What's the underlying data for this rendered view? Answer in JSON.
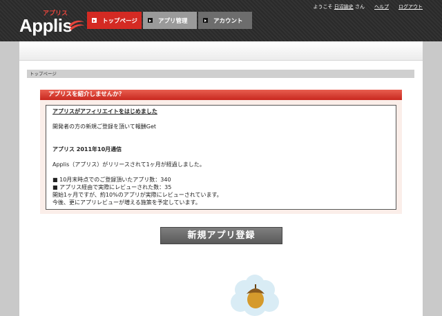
{
  "brand": {
    "name": "Applis",
    "ruby": "アプリス"
  },
  "nav": {
    "items": [
      {
        "label": "トップページ",
        "active": true
      },
      {
        "label": "アプリ管理",
        "active": false
      },
      {
        "label": "アカウント",
        "active": false
      }
    ]
  },
  "user": {
    "greeting": "ようこそ",
    "name": "日沼諭史",
    "suffix": "さん",
    "help": "ヘルプ",
    "logout": "ログアウト"
  },
  "breadcrumb": "トップページ",
  "notice": {
    "heading": "アプリスを紹介しませんか？",
    "title": "アプリスがアフィリエイトをはじめました",
    "intro": "開発者の方の新規ご登録を頂いて報酬Get",
    "newsletter_title": "アプリス 2011年10月通信",
    "newsletter_lead": "Applis（アプリス）がリリースされて1ヶ月が経過しました。",
    "lines": [
      "■ 10月末時点でのご登録頂いたアプリ数：340",
      "■ アプリス経由で実際にレビューされた数：35",
      "開始1ヶ月ですが、約10%のアプリが実際にレビューされています。",
      "今後、更にアプリレビューが増える施策を予定しています。"
    ]
  },
  "register_button": "新規アプリ登録",
  "colors": {
    "accent": "#d42a23",
    "header_bg": "#2f2f2f"
  }
}
